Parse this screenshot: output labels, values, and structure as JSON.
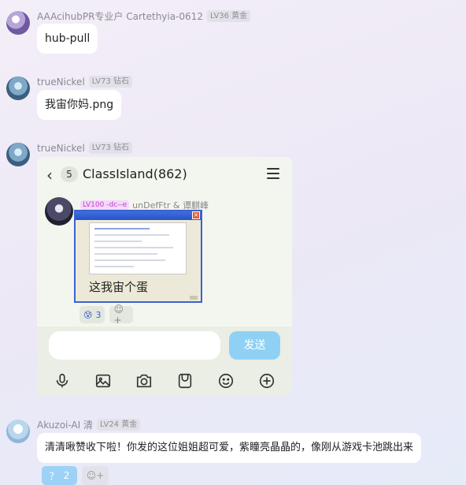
{
  "messages": [
    {
      "sender": "AAAcihubPR专业户 Cartethyia-0612",
      "badge": "LV36 黄金",
      "text": "hub-pull"
    },
    {
      "sender": "trueNickel",
      "badge": "LV73 钻石",
      "text": "我宙你妈.png"
    },
    {
      "sender": "trueNickel",
      "badge": "LV73 钻石"
    },
    {
      "sender": "Akuzoi-AI 清",
      "badge": "LV24 黄金",
      "text": "清清啾赞收下啦！你发的这位姐姐超可爱，紫瞳亮晶晶的，像刚从游戏卡池跳出来",
      "reaction_label": "？",
      "reaction_count": "2"
    }
  ],
  "embedded": {
    "unread_count": "5",
    "group_title": "ClassIsland(862)",
    "inner_level": "LV100 -dc--e",
    "inner_sender": "unDefFtr & 谭麒峰",
    "image_caption": "这我宙个蛋",
    "reaction_emoji": "😰",
    "reaction_count": "3",
    "send_label": "发送",
    "toolbar_icons": [
      "microphone-icon",
      "image-icon",
      "camera-icon",
      "sticker-icon",
      "emoji-icon",
      "plus-icon"
    ]
  }
}
